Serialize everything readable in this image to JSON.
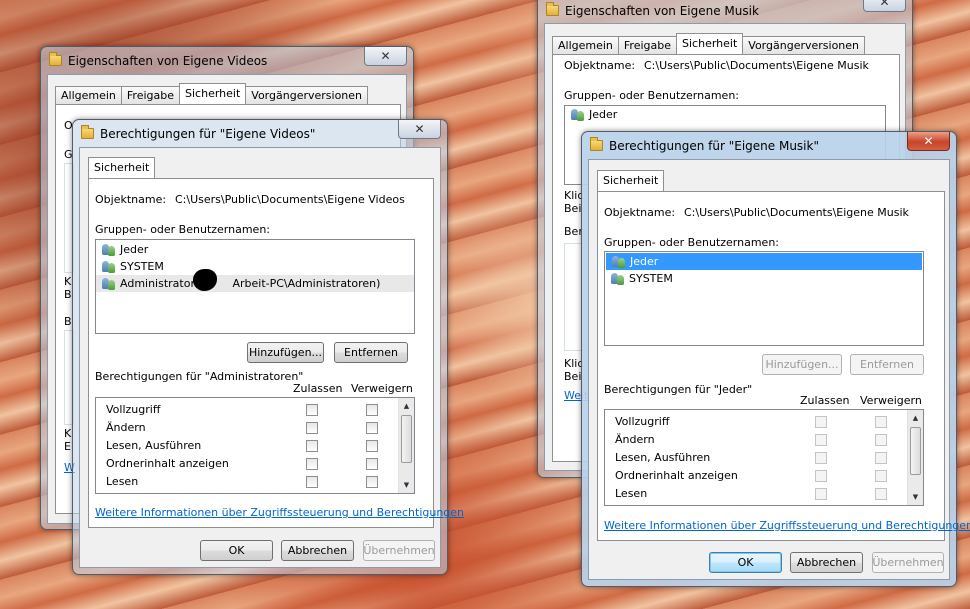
{
  "w1": {
    "title": "Eigenschaften von Eigene Videos",
    "tabs": [
      "Allgemein",
      "Freigabe",
      "Sicherheit",
      "Vorgängerversionen"
    ],
    "clipped_labels": [
      "O",
      "G",
      "K",
      "B",
      "B",
      "K",
      "E",
      "W"
    ]
  },
  "w2": {
    "title": "Berechtigungen für \"Eigene Videos\"",
    "tab": "Sicherheit",
    "object_label": "Objektname:",
    "object_value": "C:\\Users\\Public\\Documents\\Eigene Videos",
    "groups_label": "Gruppen- oder Benutzernamen:",
    "groups": [
      "Jeder",
      "SYSTEM",
      "Administratoren",
      "Arbeit-PC\\Administratoren)"
    ],
    "add_button": "Hinzufügen...",
    "remove_button": "Entfernen",
    "perms_label": "Berechtigungen für \"Administratoren\"",
    "allow_header": "Zulassen",
    "deny_header": "Verweigern",
    "permissions": [
      "Vollzugriff",
      "Ändern",
      "Lesen, Ausführen",
      "Ordnerinhalt anzeigen",
      "Lesen"
    ],
    "link": "Weitere Informationen über Zugriffssteuerung und Berechtigungen",
    "ok": "OK",
    "cancel": "Abbrechen",
    "apply": "Übernehmen"
  },
  "w3": {
    "title": "Eigenschaften von Eigene Musik",
    "tabs": [
      "Allgemein",
      "Freigabe",
      "Sicherheit",
      "Vorgängerversionen"
    ],
    "object_label": "Objektname:",
    "object_value": "C:\\Users\\Public\\Documents\\Eigene Musik",
    "groups_label": "Gruppen- oder Benutzernamen:",
    "first_group": "Jeder",
    "clipped_labels": [
      "Klic",
      "Bei",
      "Ber",
      "Klic",
      "Bei",
      "Weit"
    ]
  },
  "w4": {
    "title": "Berechtigungen für \"Eigene Musik\"",
    "tab": "Sicherheit",
    "object_label": "Objektname:",
    "object_value": "C:\\Users\\Public\\Documents\\Eigene Musik",
    "groups_label": "Gruppen- oder Benutzernamen:",
    "groups": [
      "Jeder",
      "SYSTEM"
    ],
    "add_button": "Hinzufügen...",
    "remove_button": "Entfernen",
    "perms_label": "Berechtigungen für \"Jeder\"",
    "allow_header": "Zulassen",
    "deny_header": "Verweigern",
    "permissions": [
      "Vollzugriff",
      "Ändern",
      "Lesen, Ausführen",
      "Ordnerinhalt anzeigen",
      "Lesen"
    ],
    "link": "Weitere Informationen über Zugriffssteuerung und Berechtigungen",
    "ok": "OK",
    "cancel": "Abbrechen",
    "apply": "Übernehmen"
  },
  "icons": {
    "folder": "folder-icon",
    "close": "close-icon",
    "user_group": "user-group-icon",
    "scroll_up": "scroll-up-arrow-icon",
    "scroll_down": "scroll-down-arrow-icon"
  }
}
